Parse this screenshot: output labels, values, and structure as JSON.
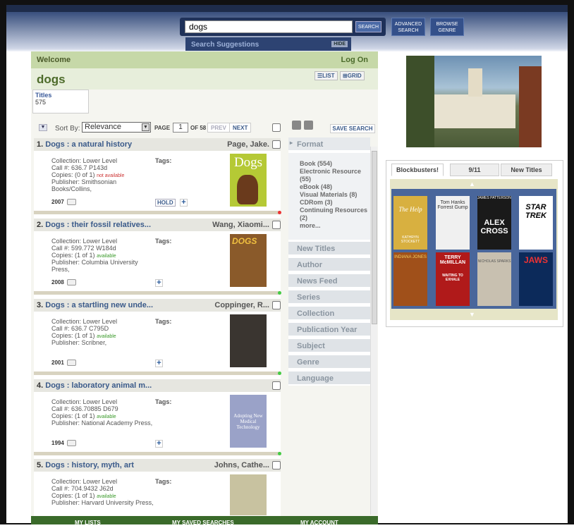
{
  "search": {
    "value": "dogs",
    "button": "SEARCH",
    "suggestions": "Search Suggestions",
    "hide": "HIDE"
  },
  "topnav": {
    "advanced": "ADVANCED SEARCH",
    "browse": "BROWSE GENRE"
  },
  "welcome": {
    "label": "Welcome",
    "logon": "Log On"
  },
  "query_title": "dogs",
  "views": {
    "list": "LIST",
    "grid": "GRID"
  },
  "titles_tab": {
    "label": "Titles",
    "count": "575"
  },
  "sort": {
    "label": "Sort By:",
    "value": "Relevance",
    "page_label": "PAGE",
    "page": "1",
    "of": "OF 58",
    "prev": "PREV",
    "next": "NEXT",
    "save": "SAVE SEARCH"
  },
  "records": [
    {
      "num": "1.",
      "title": "Dogs : a natural history",
      "author": "Page, Jake.",
      "collection": "Lower Level",
      "call": "636.7 P143d",
      "copies": "(0 of 1)",
      "status": "not available",
      "publisher": "Smithsonian Books/Collins,",
      "year": "2007",
      "hold": "HOLD",
      "cover": "Dogs"
    },
    {
      "num": "2.",
      "title": "Dogs : their fossil relatives...",
      "author": "Wang, Xiaomi...",
      "collection": "Lower Level",
      "call": "599.772 W184d",
      "copies": "(1 of 1)",
      "status": "available",
      "publisher": "Columbia University Press,",
      "year": "2008",
      "cover": "DOGS"
    },
    {
      "num": "3.",
      "title": "Dogs : a startling new unde...",
      "author": "Coppinger, R...",
      "collection": "Lower Level",
      "call": "636.7 C795D",
      "copies": "(1 of 1)",
      "status": "available",
      "publisher": "Scribner,",
      "year": "2001"
    },
    {
      "num": "4.",
      "title": "Dogs : laboratory animal m...",
      "author": "",
      "collection": "Lower Level",
      "call": "636.70885 D679",
      "copies": "(1 of 1)",
      "status": "available",
      "publisher": "National Academy Press,",
      "year": "1994",
      "cover": "Adopting New Medical Technology"
    },
    {
      "num": "5.",
      "title": "Dogs : history, myth, art",
      "author": "Johns, Cathe...",
      "collection": "Lower Level",
      "call": "704.9432 J62d",
      "copies": "(1 of 1)",
      "status": "available",
      "publisher": "Harvard University Press,"
    }
  ],
  "field_labels": {
    "collection": "Collection:",
    "call": "Call #:",
    "copies": "Copies:",
    "publisher": "Publisher:",
    "tags": "Tags:"
  },
  "facets": {
    "format_title": "Format",
    "format_items": [
      "Book (554)",
      "Electronic Resource (55)",
      "eBook (48)",
      "Visual Materials (8)",
      "CDRom (3)",
      "Continuing Resources (2)",
      "more..."
    ],
    "others": [
      "New Titles",
      "Author",
      "News Feed",
      "Series",
      "Collection",
      "Publication Year",
      "Subject",
      "Genre",
      "Language"
    ]
  },
  "bottom": {
    "lists": "MY LISTS",
    "saved": "MY SAVED SEARCHES",
    "account": "MY ACCOUNT"
  },
  "carousel": {
    "tabs": [
      "Blockbusters!",
      "9/11",
      "New Titles"
    ],
    "books": [
      {
        "t1": "The Help",
        "t2": "KATHRYN STOCKETT"
      },
      {
        "t1": "Tom Hanks",
        "t2": "Forrest Gump"
      },
      {
        "t1": "JAMES PATTERSON",
        "t2": "ALEX CROSS"
      },
      {
        "t1": "STAR TREK",
        "t2": ""
      },
      {
        "t1": "INDIANA JONES",
        "t2": ""
      },
      {
        "t1": "TERRY McMILLAN",
        "t2": "WAITING TO EXHALE"
      },
      {
        "t1": "NICHOLAS SPARKS",
        "t2": ""
      },
      {
        "t1": "JAWS",
        "t2": ""
      }
    ]
  }
}
